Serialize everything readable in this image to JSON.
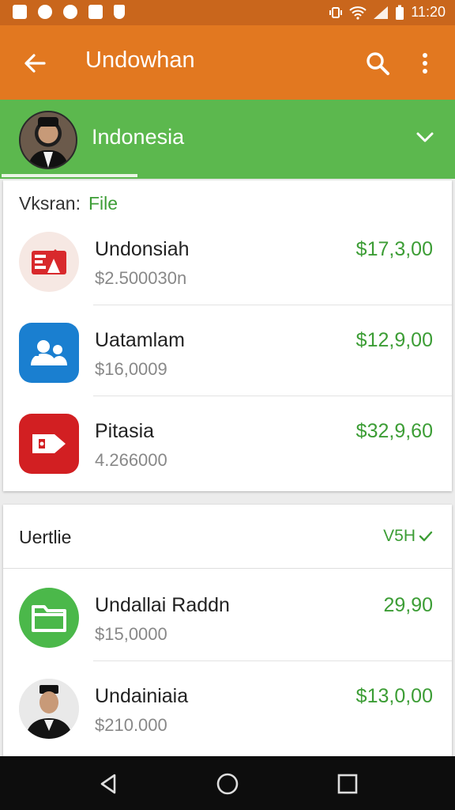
{
  "status_bar": {
    "time": "11:20",
    "icons": [
      "notification-icon",
      "circle-icon",
      "message-icon",
      "mail-icon",
      "shield-icon",
      "vibrate-icon",
      "wifi-icon",
      "signal-icon",
      "battery-icon"
    ]
  },
  "app_bar": {
    "title": "Undowhan",
    "icons": [
      "back-arrow-icon",
      "search-icon",
      "more-vert-icon"
    ]
  },
  "country_header": {
    "name": "Indonesia",
    "icon": "chevron-down-icon"
  },
  "section1": {
    "label": "Vksran:",
    "link": "File",
    "items": [
      {
        "name": "Undonsiah",
        "sub": "$2.500030n",
        "amount": "$17,3,00",
        "icon": "document-icon"
      },
      {
        "name": "Uatamlam",
        "sub": "$16,0009",
        "amount": "$12,9,00",
        "icon": "contacts-icon"
      },
      {
        "name": "Pitasia",
        "sub": "4.266000",
        "amount": "$32,9,60",
        "icon": "tag-icon"
      }
    ]
  },
  "section2": {
    "label": "Uertlie",
    "action": "V5H",
    "items": [
      {
        "name": "Undallai Raddn",
        "sub": "$15,0000",
        "amount": "29,90",
        "icon": "folder-icon"
      },
      {
        "name": "Undainiaia",
        "sub": "$210.000",
        "amount": "$13,0,00",
        "icon": "person-avatar"
      }
    ]
  },
  "colors": {
    "app_bar": "#e27820",
    "header_green": "#5cb84e",
    "amount_green": "#3c9d35"
  }
}
